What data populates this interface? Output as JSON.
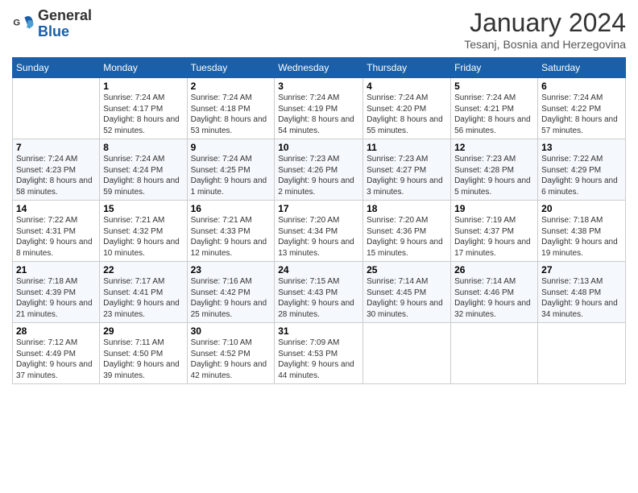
{
  "header": {
    "logo_general": "General",
    "logo_blue": "Blue",
    "month_title": "January 2024",
    "location": "Tesanj, Bosnia and Herzegovina"
  },
  "weekdays": [
    "Sunday",
    "Monday",
    "Tuesday",
    "Wednesday",
    "Thursday",
    "Friday",
    "Saturday"
  ],
  "weeks": [
    [
      {
        "day": "",
        "sunrise": "",
        "sunset": "",
        "daylight": ""
      },
      {
        "day": "1",
        "sunrise": "Sunrise: 7:24 AM",
        "sunset": "Sunset: 4:17 PM",
        "daylight": "Daylight: 8 hours and 52 minutes."
      },
      {
        "day": "2",
        "sunrise": "Sunrise: 7:24 AM",
        "sunset": "Sunset: 4:18 PM",
        "daylight": "Daylight: 8 hours and 53 minutes."
      },
      {
        "day": "3",
        "sunrise": "Sunrise: 7:24 AM",
        "sunset": "Sunset: 4:19 PM",
        "daylight": "Daylight: 8 hours and 54 minutes."
      },
      {
        "day": "4",
        "sunrise": "Sunrise: 7:24 AM",
        "sunset": "Sunset: 4:20 PM",
        "daylight": "Daylight: 8 hours and 55 minutes."
      },
      {
        "day": "5",
        "sunrise": "Sunrise: 7:24 AM",
        "sunset": "Sunset: 4:21 PM",
        "daylight": "Daylight: 8 hours and 56 minutes."
      },
      {
        "day": "6",
        "sunrise": "Sunrise: 7:24 AM",
        "sunset": "Sunset: 4:22 PM",
        "daylight": "Daylight: 8 hours and 57 minutes."
      }
    ],
    [
      {
        "day": "7",
        "sunrise": "Sunrise: 7:24 AM",
        "sunset": "Sunset: 4:23 PM",
        "daylight": "Daylight: 8 hours and 58 minutes."
      },
      {
        "day": "8",
        "sunrise": "Sunrise: 7:24 AM",
        "sunset": "Sunset: 4:24 PM",
        "daylight": "Daylight: 8 hours and 59 minutes."
      },
      {
        "day": "9",
        "sunrise": "Sunrise: 7:24 AM",
        "sunset": "Sunset: 4:25 PM",
        "daylight": "Daylight: 9 hours and 1 minute."
      },
      {
        "day": "10",
        "sunrise": "Sunrise: 7:23 AM",
        "sunset": "Sunset: 4:26 PM",
        "daylight": "Daylight: 9 hours and 2 minutes."
      },
      {
        "day": "11",
        "sunrise": "Sunrise: 7:23 AM",
        "sunset": "Sunset: 4:27 PM",
        "daylight": "Daylight: 9 hours and 3 minutes."
      },
      {
        "day": "12",
        "sunrise": "Sunrise: 7:23 AM",
        "sunset": "Sunset: 4:28 PM",
        "daylight": "Daylight: 9 hours and 5 minutes."
      },
      {
        "day": "13",
        "sunrise": "Sunrise: 7:22 AM",
        "sunset": "Sunset: 4:29 PM",
        "daylight": "Daylight: 9 hours and 6 minutes."
      }
    ],
    [
      {
        "day": "14",
        "sunrise": "Sunrise: 7:22 AM",
        "sunset": "Sunset: 4:31 PM",
        "daylight": "Daylight: 9 hours and 8 minutes."
      },
      {
        "day": "15",
        "sunrise": "Sunrise: 7:21 AM",
        "sunset": "Sunset: 4:32 PM",
        "daylight": "Daylight: 9 hours and 10 minutes."
      },
      {
        "day": "16",
        "sunrise": "Sunrise: 7:21 AM",
        "sunset": "Sunset: 4:33 PM",
        "daylight": "Daylight: 9 hours and 12 minutes."
      },
      {
        "day": "17",
        "sunrise": "Sunrise: 7:20 AM",
        "sunset": "Sunset: 4:34 PM",
        "daylight": "Daylight: 9 hours and 13 minutes."
      },
      {
        "day": "18",
        "sunrise": "Sunrise: 7:20 AM",
        "sunset": "Sunset: 4:36 PM",
        "daylight": "Daylight: 9 hours and 15 minutes."
      },
      {
        "day": "19",
        "sunrise": "Sunrise: 7:19 AM",
        "sunset": "Sunset: 4:37 PM",
        "daylight": "Daylight: 9 hours and 17 minutes."
      },
      {
        "day": "20",
        "sunrise": "Sunrise: 7:18 AM",
        "sunset": "Sunset: 4:38 PM",
        "daylight": "Daylight: 9 hours and 19 minutes."
      }
    ],
    [
      {
        "day": "21",
        "sunrise": "Sunrise: 7:18 AM",
        "sunset": "Sunset: 4:39 PM",
        "daylight": "Daylight: 9 hours and 21 minutes."
      },
      {
        "day": "22",
        "sunrise": "Sunrise: 7:17 AM",
        "sunset": "Sunset: 4:41 PM",
        "daylight": "Daylight: 9 hours and 23 minutes."
      },
      {
        "day": "23",
        "sunrise": "Sunrise: 7:16 AM",
        "sunset": "Sunset: 4:42 PM",
        "daylight": "Daylight: 9 hours and 25 minutes."
      },
      {
        "day": "24",
        "sunrise": "Sunrise: 7:15 AM",
        "sunset": "Sunset: 4:43 PM",
        "daylight": "Daylight: 9 hours and 28 minutes."
      },
      {
        "day": "25",
        "sunrise": "Sunrise: 7:14 AM",
        "sunset": "Sunset: 4:45 PM",
        "daylight": "Daylight: 9 hours and 30 minutes."
      },
      {
        "day": "26",
        "sunrise": "Sunrise: 7:14 AM",
        "sunset": "Sunset: 4:46 PM",
        "daylight": "Daylight: 9 hours and 32 minutes."
      },
      {
        "day": "27",
        "sunrise": "Sunrise: 7:13 AM",
        "sunset": "Sunset: 4:48 PM",
        "daylight": "Daylight: 9 hours and 34 minutes."
      }
    ],
    [
      {
        "day": "28",
        "sunrise": "Sunrise: 7:12 AM",
        "sunset": "Sunset: 4:49 PM",
        "daylight": "Daylight: 9 hours and 37 minutes."
      },
      {
        "day": "29",
        "sunrise": "Sunrise: 7:11 AM",
        "sunset": "Sunset: 4:50 PM",
        "daylight": "Daylight: 9 hours and 39 minutes."
      },
      {
        "day": "30",
        "sunrise": "Sunrise: 7:10 AM",
        "sunset": "Sunset: 4:52 PM",
        "daylight": "Daylight: 9 hours and 42 minutes."
      },
      {
        "day": "31",
        "sunrise": "Sunrise: 7:09 AM",
        "sunset": "Sunset: 4:53 PM",
        "daylight": "Daylight: 9 hours and 44 minutes."
      },
      {
        "day": "",
        "sunrise": "",
        "sunset": "",
        "daylight": ""
      },
      {
        "day": "",
        "sunrise": "",
        "sunset": "",
        "daylight": ""
      },
      {
        "day": "",
        "sunrise": "",
        "sunset": "",
        "daylight": ""
      }
    ]
  ]
}
